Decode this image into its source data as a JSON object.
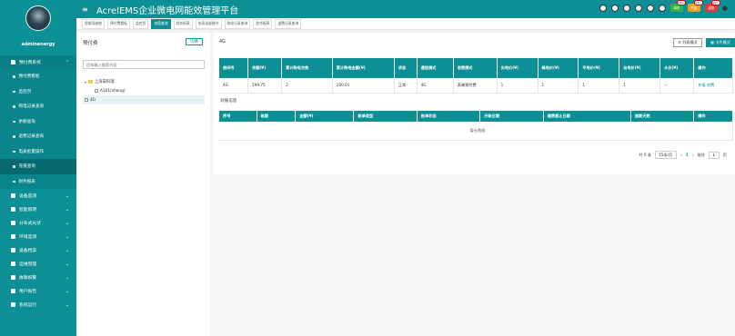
{
  "colors": {
    "primary": "#0d8f96",
    "badge_green": "#35b34a",
    "badge_orange": "#f0a020",
    "badge_red": "#e03c3c"
  },
  "header": {
    "title": "AcrelEMS企业微电网能效管理平台"
  },
  "user": {
    "name": "adminenergy"
  },
  "header_badges": [
    {
      "label": "事件",
      "count": "99+",
      "color": "#35b34a"
    },
    {
      "label": "严重",
      "count": "99+",
      "color": "#f0a020"
    },
    {
      "label": "越限",
      "count": "99+",
      "color": "#e03c3c"
    }
  ],
  "sidebar": {
    "items": [
      {
        "label": "预付费系统",
        "expanded": true,
        "active": true,
        "children": [
          {
            "label": "预付费看板"
          },
          {
            "label": "监控页"
          },
          {
            "label": "购电记录查询"
          },
          {
            "label": "余额查询"
          },
          {
            "label": "退费记录查询"
          },
          {
            "label": "电表批量操作"
          },
          {
            "label": "充值查询",
            "active": true
          },
          {
            "label": "财务报表"
          }
        ]
      },
      {
        "label": "设备监测"
      },
      {
        "label": "智能照明"
      },
      {
        "label": "分布式光伏"
      },
      {
        "label": "环境监测"
      },
      {
        "label": "设备档案"
      },
      {
        "label": "运维管理"
      },
      {
        "label": "故障报警"
      },
      {
        "label": "用户报告"
      },
      {
        "label": "系统运行"
      }
    ]
  },
  "tabs": [
    "智能驾驶舱",
    "预付费看板",
    "监控页",
    "充值查询",
    "财务报表",
    "电表批量操作",
    "购电记录查询",
    "综合报表",
    "退费记录查询"
  ],
  "active_tab": 3,
  "left_panel": {
    "title": "预付费",
    "button": "切换",
    "search_placeholder": "回车输入搜索内容",
    "tree": {
      "root": "上海安科瑞",
      "child": "A101(zhang)",
      "selected": "4G"
    }
  },
  "right_panel": {
    "title": "4G",
    "buttons": {
      "list": "≡ 列表模式",
      "card": "▦ 卡片模式"
    },
    "table1": {
      "headers": [
        "房间号",
        "余额(¥)",
        "累计购电次数",
        "累计购电金额(¥)",
        "状态",
        "通信模式",
        "收费模式",
        "尖电价(¥)",
        "峰电价(¥)",
        "平电价(¥)",
        "谷电价(¥)",
        "水价(¥)",
        "操作"
      ],
      "row": [
        "4G",
        "199.75",
        "2",
        "200.01",
        "正常",
        "4G",
        "表端预付费",
        "1",
        "1",
        "1",
        "1",
        "--",
        "充值 退费"
      ]
    },
    "sub_title": "对账信息",
    "table2": {
      "headers": [
        "序号",
        "账期",
        "金额(¥)",
        "账单类型",
        "账单状态",
        "开账日期",
        "缴费截止日期",
        "逾期天数",
        "操作"
      ],
      "empty": "暂无数据"
    },
    "pagination": {
      "total": "共 0 条",
      "page_size": "15条/页",
      "prev": "‹",
      "current": "1",
      "next": "›",
      "goto_label": "前往",
      "goto_value": "1",
      "page_unit": "页"
    }
  }
}
